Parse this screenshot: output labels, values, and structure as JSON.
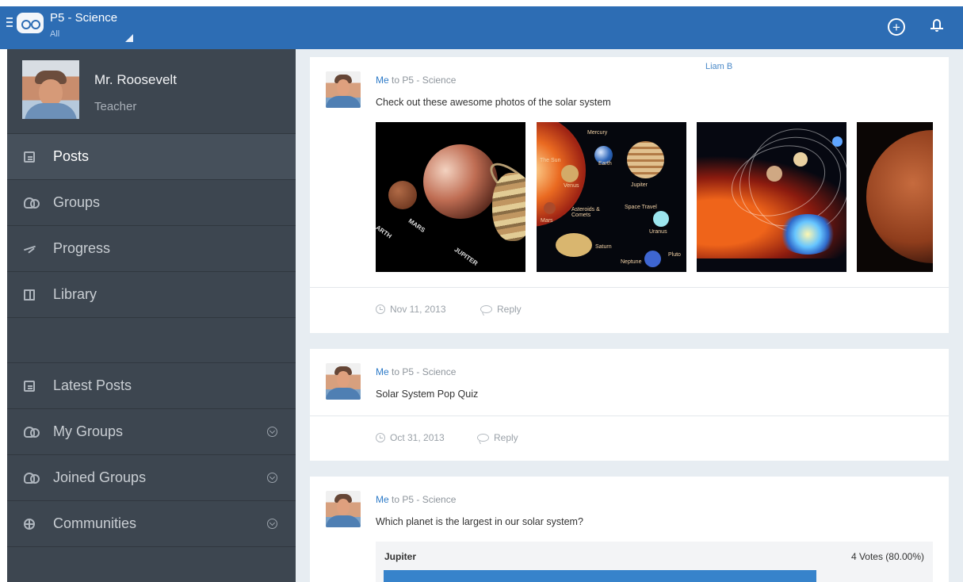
{
  "app": {
    "class_title": "P5 - Science",
    "class_filter": "All"
  },
  "sidebar": {
    "profile": {
      "name": "Mr. Roosevelt",
      "role": "Teacher"
    },
    "primary_items": [
      {
        "label": "Posts",
        "icon": "comment-icon",
        "active": true
      },
      {
        "label": "Groups",
        "icon": "groups-icon"
      },
      {
        "label": "Progress",
        "icon": "progress-icon"
      },
      {
        "label": "Library",
        "icon": "library-icon"
      }
    ],
    "secondary_items": [
      {
        "label": "Latest Posts",
        "icon": "comment-icon"
      },
      {
        "label": "My Groups",
        "icon": "groups-icon",
        "expand_icon": "chevron-down-circle-icon"
      },
      {
        "label": "Joined Groups",
        "icon": "groups-icon",
        "expand_icon": "chevron-down-circle-icon"
      },
      {
        "label": "Communities",
        "icon": "globe-icon",
        "expand_icon": "chevron-down-circle-icon"
      }
    ]
  },
  "posts": [
    {
      "sender": "Me",
      "recipient_text": " to P5 - Science",
      "tag": "Liam B",
      "text": "Check out these awesome photos of the solar system",
      "date": "Nov 11, 2013",
      "reply_label": "Reply",
      "images": [
        {
          "labels": [
            "ARTH",
            "MARS",
            "JUPITER"
          ]
        },
        {
          "labels": [
            "The Sun",
            "Mercury",
            "Earth",
            "Jupiter",
            "Venus",
            "Mars",
            "Asteroids & Comets",
            "Space Travel",
            "Saturn",
            "Uranus",
            "Neptune",
            "Pluto"
          ]
        },
        {
          "labels": []
        },
        {
          "labels": []
        }
      ]
    },
    {
      "sender": "Me",
      "recipient_text": " to P5 - Science",
      "text": "Solar System Pop Quiz",
      "date": "Oct 31, 2013",
      "reply_label": "Reply"
    },
    {
      "sender": "Me",
      "recipient_text": " to P5 - Science",
      "text": "Which planet is the largest in our solar system?",
      "poll": {
        "option": "Jupiter",
        "votes": "4 Votes (80.00%)",
        "fraction": 0.8
      }
    }
  ],
  "colors": {
    "topbar": "#2d6db4",
    "sidebar": "#3d4650",
    "accent": "#3783cb",
    "main_background": "#e7edf2"
  }
}
